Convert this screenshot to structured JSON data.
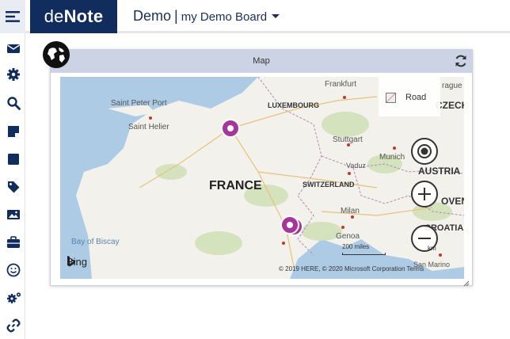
{
  "brand": {
    "prefix": "de",
    "suffix": "Note"
  },
  "header": {
    "board_name": "Demo",
    "separator": "|",
    "board_select": "my Demo Board"
  },
  "sidebar": {
    "icons": [
      "menu-icon",
      "mail-icon",
      "gear-icon",
      "search-icon",
      "note-icon",
      "square-icon",
      "tag-icon",
      "image-icon",
      "briefcase-icon",
      "smiley-icon",
      "gears-icon",
      "link-icon"
    ]
  },
  "widget": {
    "title": "Map",
    "map_style": "Road",
    "attribution": "© 2019 HERE, © 2020 Microsoft Corporation  Terms",
    "bing": "Bing",
    "scale": "200 miles",
    "scale_km": "km",
    "labels": {
      "france": "FRANCE",
      "switzerland": "SWITZERLAND",
      "luxembourg": "LUXEMBOURG",
      "austria": "AUSTRIA",
      "czech": "CZECH RE",
      "slovenia": "OVEN",
      "croatia": "CROATIA",
      "bay": "Bay of Biscay",
      "frankfurt": "Frankfurt",
      "prague": "rague",
      "stuttgart": "Stuttgart",
      "munich": "Munich",
      "vaduz": "Vaduz",
      "milan": "Milan",
      "genoa": "Genoa",
      "saint_peter_port": "Saint Peter Port",
      "saint_helier": "Saint Helier",
      "san_marino": "San Marino"
    },
    "pins": [
      "location-pin",
      "location-pin",
      "location-pin"
    ]
  },
  "colors": {
    "brand": "#112d5e",
    "pin": "#a6369a",
    "title_bar": "#cbd3e4"
  }
}
